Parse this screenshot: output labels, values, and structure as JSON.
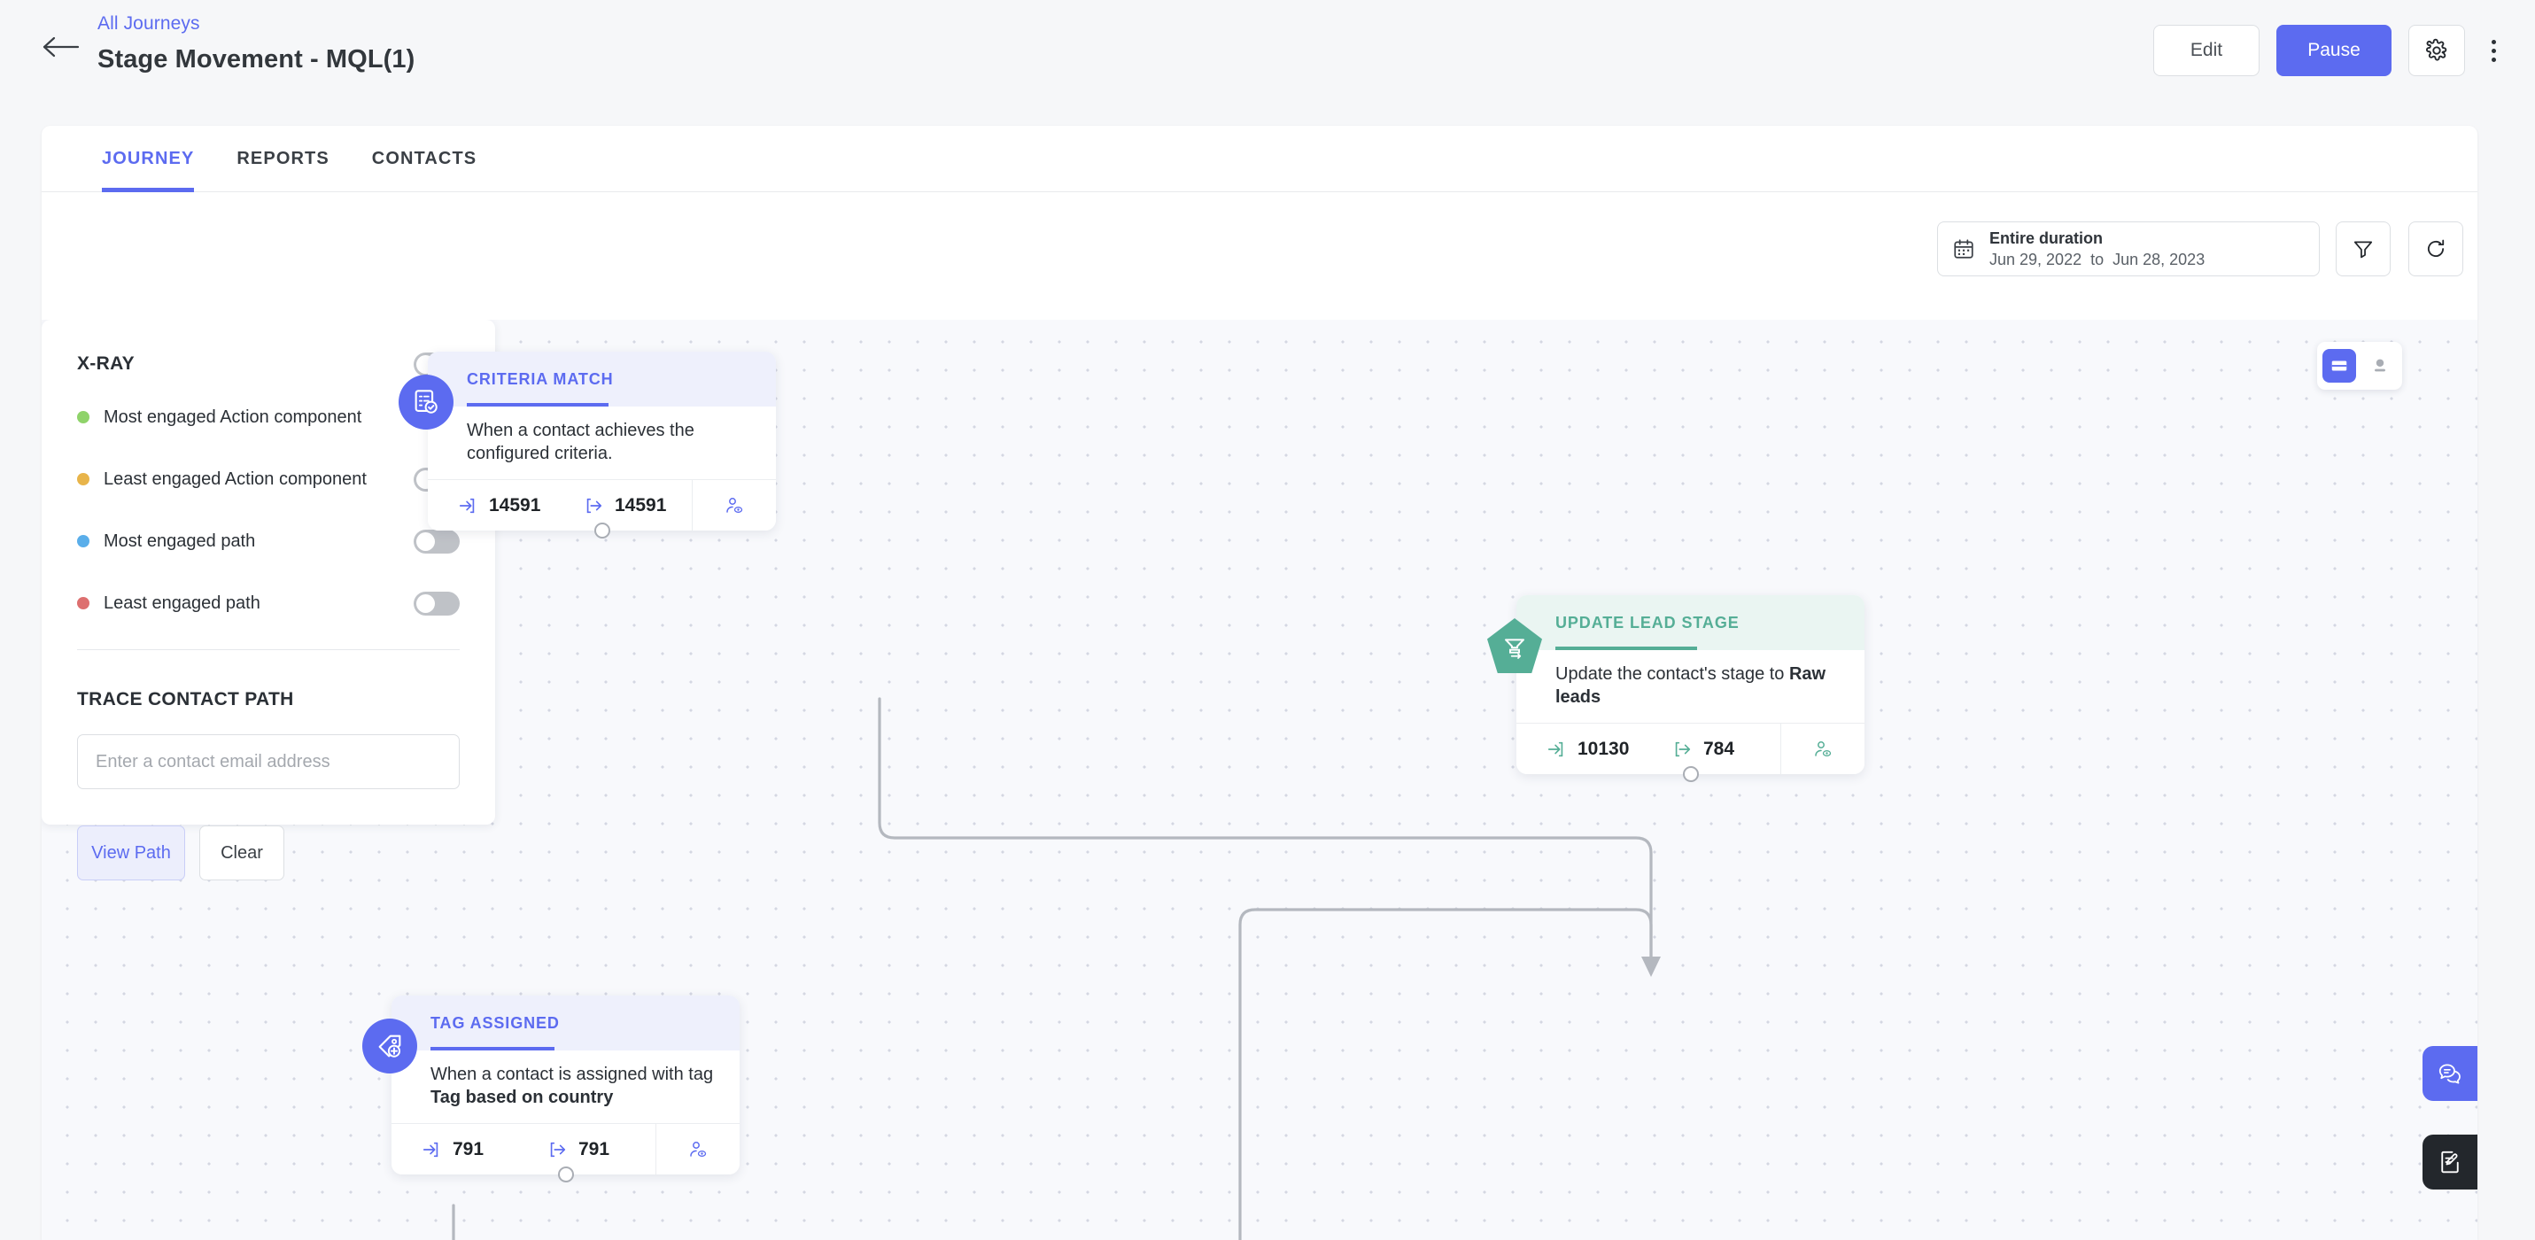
{
  "header": {
    "breadcrumb": "All Journeys",
    "title": "Stage Movement - MQL(1)",
    "back_icon": "arrow-left-icon",
    "edit_label": "Edit",
    "pause_label": "Pause",
    "settings_icon": "gear-icon",
    "more_icon": "kebab-menu-icon",
    "accent_color": "#5c6bf0"
  },
  "tabs": [
    {
      "label": "JOURNEY",
      "active": true
    },
    {
      "label": "REPORTS",
      "active": false
    },
    {
      "label": "CONTACTS",
      "active": false
    }
  ],
  "toolbar": {
    "calendar_icon": "calendar-icon",
    "date_title": "Entire duration",
    "date_from": "Jun 29, 2022",
    "date_sep": "to",
    "date_to": "Jun 28, 2023",
    "filter_icon": "filter-icon",
    "refresh_icon": "refresh-icon"
  },
  "xray": {
    "title": "X-RAY",
    "master_toggle": false,
    "items": [
      {
        "label": "Most engaged Action component",
        "color": "#8fd36a",
        "on": false
      },
      {
        "label": "Least engaged Action component",
        "color": "#e8b44a",
        "on": false
      },
      {
        "label": "Most engaged path",
        "color": "#5aaeea",
        "on": false
      },
      {
        "label": "Least engaged path",
        "color": "#dd6f6f",
        "on": false
      }
    ]
  },
  "trace": {
    "title": "TRACE CONTACT PATH",
    "input_value": "",
    "input_placeholder": "Enter a contact email address",
    "view_path_label": "View Path",
    "clear_label": "Clear"
  },
  "viewmode": {
    "card_icon": "card-view-icon",
    "person_icon": "person-view-icon",
    "active": "card-view-icon"
  },
  "nodes": [
    {
      "id": "criteria-match",
      "type": "trigger",
      "badge_icon": "checklist-check-icon",
      "badge_shape": "circle",
      "accent": "#5c6bf0",
      "head_bg": "#eef0fc",
      "title": "CRITERIA MATCH",
      "description": "When a contact achieves the configured criteria.",
      "description_bold": "",
      "entered_icon": "arrow-enter-icon",
      "entered": "14591",
      "exited_icon": "arrow-exit-icon",
      "exited": "14591",
      "view_contacts_icon": "user-eye-icon"
    },
    {
      "id": "update-lead-stage",
      "type": "action",
      "badge_icon": "funnel-return-icon",
      "badge_shape": "pentagon",
      "accent": "#55ae96",
      "head_bg": "#eaf5f2",
      "title": "UPDATE LEAD STAGE",
      "description": "Update the contact's stage to ",
      "description_bold": "Raw leads",
      "entered_icon": "arrow-enter-icon",
      "entered": "10130",
      "exited_icon": "arrow-exit-icon",
      "exited": "784",
      "view_contacts_icon": "user-eye-icon"
    },
    {
      "id": "tag-assigned",
      "type": "trigger",
      "badge_icon": "tag-plus-icon",
      "badge_shape": "circle",
      "accent": "#5c6bf0",
      "head_bg": "#eef0fc",
      "title": "TAG ASSIGNED",
      "description": "When a contact is assigned with tag ",
      "description_bold": "Tag based on country",
      "entered_icon": "arrow-enter-icon",
      "entered": "791",
      "exited_icon": "arrow-exit-icon",
      "exited": "791",
      "view_contacts_icon": "user-eye-icon"
    }
  ],
  "fabs": {
    "chat_icon": "chat-bubbles-icon",
    "note_icon": "note-edit-icon"
  }
}
